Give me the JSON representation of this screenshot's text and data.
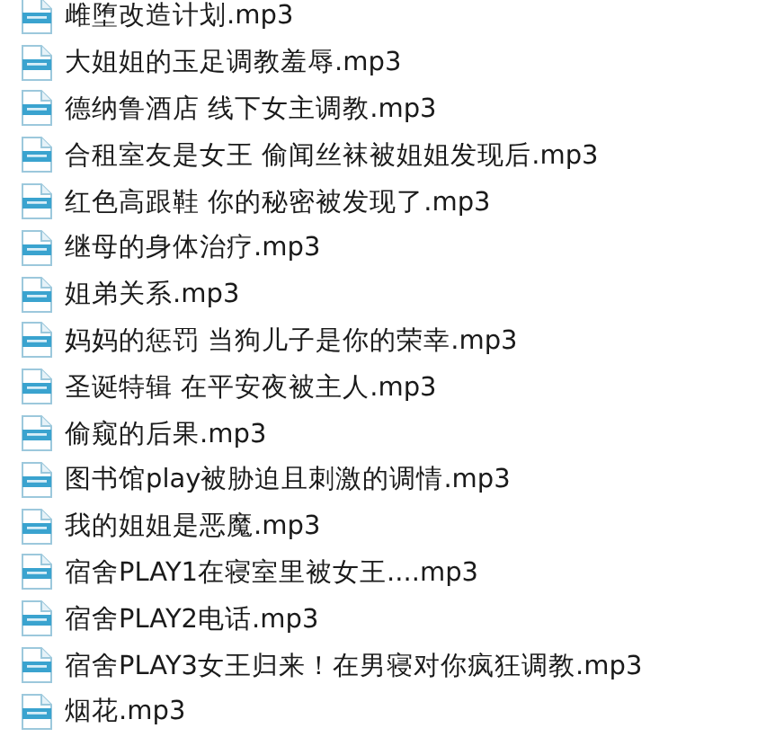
{
  "files": [
    {
      "name": "雌堕改造计划.mp3"
    },
    {
      "name": "大姐姐的玉足调教羞辱.mp3"
    },
    {
      "name": "德纳鲁酒店 线下女主调教.mp3"
    },
    {
      "name": "合租室友是女王 偷闻丝袜被姐姐发现后.mp3"
    },
    {
      "name": "红色高跟鞋 你的秘密被发现了.mp3"
    },
    {
      "name": "继母的身体治疗.mp3"
    },
    {
      "name": "姐弟关系.mp3"
    },
    {
      "name": "妈妈的惩罚 当狗儿子是你的荣幸.mp3"
    },
    {
      "name": "圣诞特辑 在平安夜被主人.mp3"
    },
    {
      "name": "偷窥的后果.mp3"
    },
    {
      "name": "图书馆play被胁迫且刺激的调情.mp3"
    },
    {
      "name": "我的姐姐是恶魔.mp3"
    },
    {
      "name": "宿舍PLAY1在寝室里被女王....mp3"
    },
    {
      "name": "宿舍PLAY2电话.mp3"
    },
    {
      "name": "宿舍PLAY3女王归来！在男寝对你疯狂调教.mp3"
    },
    {
      "name": "烟花.mp3"
    }
  ]
}
